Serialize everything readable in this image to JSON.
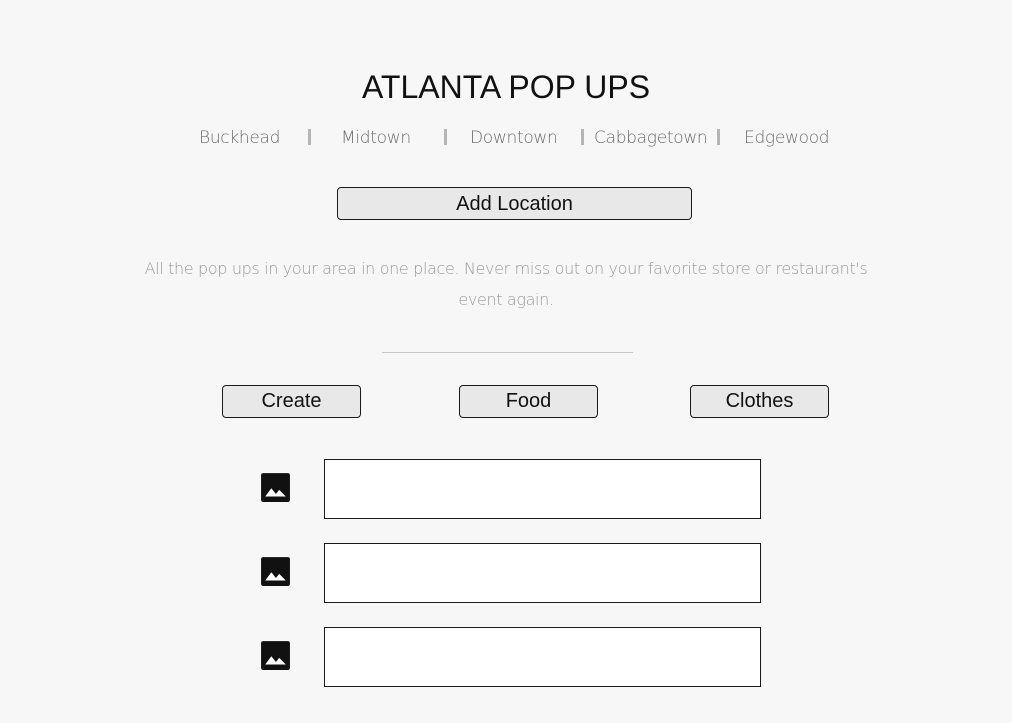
{
  "header": {
    "title": "ATLANTA POP UPS"
  },
  "nav": {
    "items": [
      {
        "label": "Buckhead"
      },
      {
        "label": "Midtown"
      },
      {
        "label": "Downtown"
      },
      {
        "label": "Cabbagetown"
      },
      {
        "label": "Edgewood"
      }
    ]
  },
  "actions": {
    "add_location_label": "Add Location"
  },
  "intro": {
    "tagline": "All the pop ups in your area in one place. Never miss out on your favorite store or restaurant's event again."
  },
  "categories": [
    {
      "label": "Create"
    },
    {
      "label": "Food"
    },
    {
      "label": "Clothes"
    }
  ],
  "listings": [
    {
      "icon": "image-icon",
      "text": ""
    },
    {
      "icon": "image-icon",
      "text": ""
    },
    {
      "icon": "image-icon",
      "text": ""
    }
  ],
  "colors": {
    "background": "#f7f7f7",
    "button_fill": "#e8e8e8",
    "nav_text": "#6d6d6d",
    "tagline_text": "#9a9a9a",
    "divider": "#c9c9c9"
  }
}
